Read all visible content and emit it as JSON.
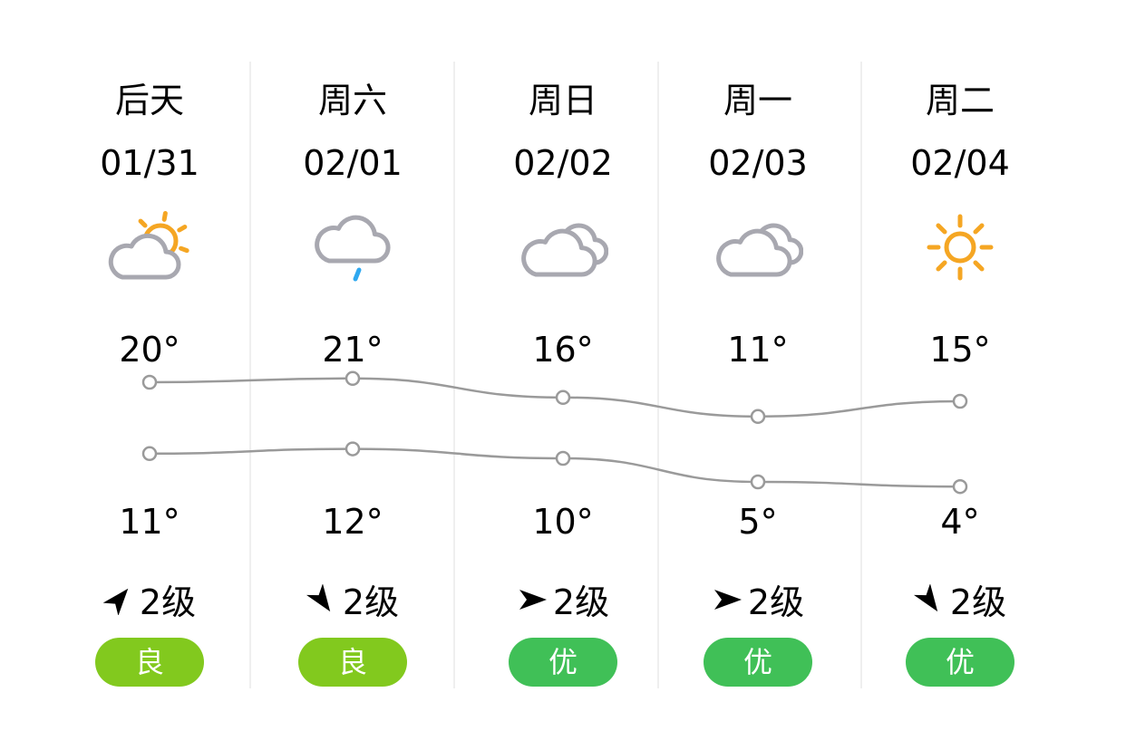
{
  "days": [
    {
      "day": "后天",
      "date": "01/31",
      "icon": "partly-cloudy-icon",
      "high": "20°",
      "low": "11°",
      "high_value": 20,
      "low_value": 11,
      "wind_dir": "northeast-arrow-icon",
      "wind_angle": -50,
      "wind": "2级",
      "aqi": "良",
      "aqi_color": "#82c91e"
    },
    {
      "day": "周六",
      "date": "02/01",
      "icon": "light-rain-icon",
      "high": "21°",
      "low": "12°",
      "high_value": 21,
      "low_value": 12,
      "wind_dir": "southeast-arrow-icon",
      "wind_angle": 55,
      "wind": "2级",
      "aqi": "良",
      "aqi_color": "#82c91e"
    },
    {
      "day": "周日",
      "date": "02/02",
      "icon": "overcast-icon",
      "high": "16°",
      "low": "10°",
      "high_value": 16,
      "low_value": 10,
      "wind_dir": "east-arrow-icon",
      "wind_angle": 0,
      "wind": "2级",
      "aqi": "优",
      "aqi_color": "#40c057"
    },
    {
      "day": "周一",
      "date": "02/03",
      "icon": "overcast-icon",
      "high": "11°",
      "low": "5°",
      "high_value": 11,
      "low_value": 5,
      "wind_dir": "east-arrow-icon",
      "wind_angle": 0,
      "wind": "2级",
      "aqi": "优",
      "aqi_color": "#40c057"
    },
    {
      "day": "周二",
      "date": "02/04",
      "icon": "sunny-icon",
      "high": "15°",
      "low": "4°",
      "high_value": 15,
      "low_value": 4,
      "wind_dir": "southeast-arrow-icon",
      "wind_angle": 55,
      "wind": "2级",
      "aqi": "优",
      "aqi_color": "#40c057"
    }
  ],
  "colors": {
    "line": "#9a9a9a",
    "cloud": "#a8a8b0",
    "sun": "#f5a623",
    "rain": "#2ea8f0"
  }
}
